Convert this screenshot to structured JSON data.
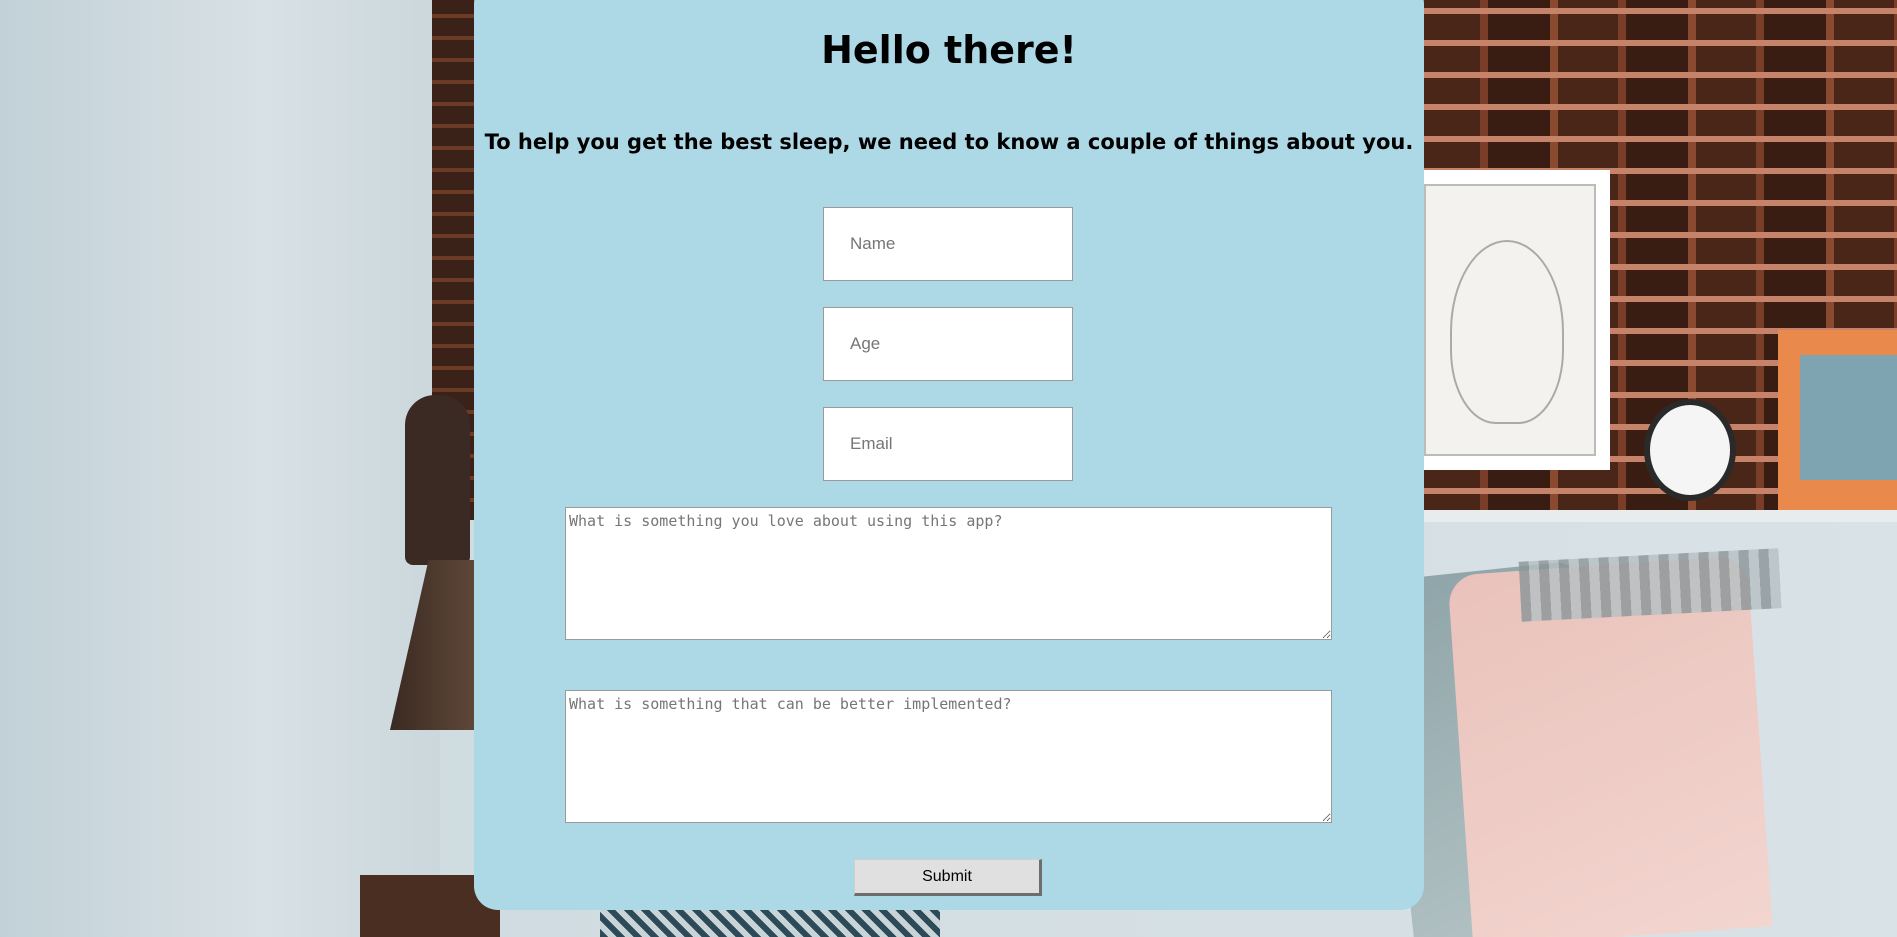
{
  "page": {
    "title": "Hello there!",
    "subtitle": "To help you get the best sleep, we need to know a couple of things about you."
  },
  "form": {
    "name": {
      "value": "",
      "placeholder": "Name"
    },
    "age": {
      "value": "",
      "placeholder": "Age"
    },
    "email": {
      "value": "",
      "placeholder": "Email"
    },
    "love_feedback": {
      "value": "",
      "placeholder": "What is something you love about using this app?"
    },
    "improve_feedback": {
      "value": "",
      "placeholder": "What is something that can be better implemented?"
    },
    "submit_label": "Submit"
  },
  "colors": {
    "card_background": "#add8e6",
    "input_background": "#ffffff",
    "button_background": "#e0e0e0",
    "text": "#000000"
  }
}
